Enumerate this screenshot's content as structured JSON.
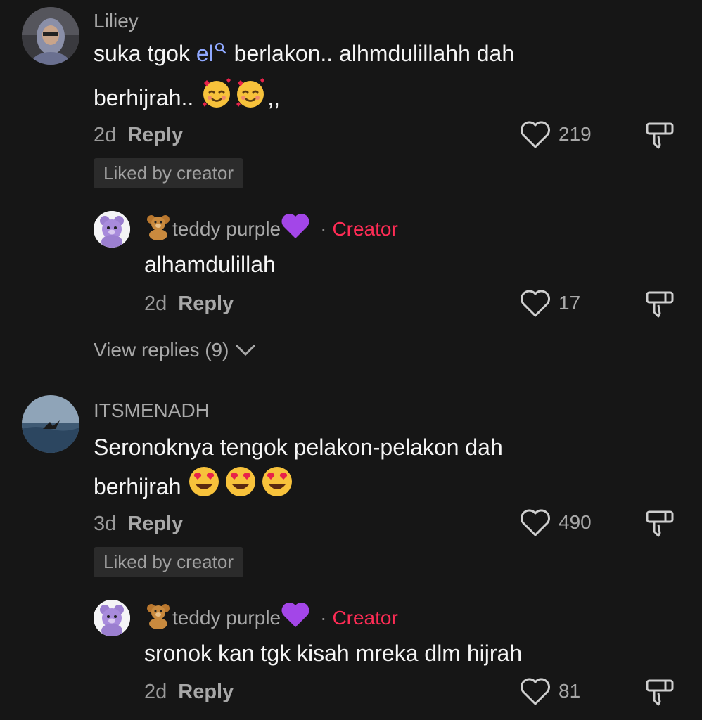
{
  "comments": [
    {
      "username": "Liliey",
      "text_before": "suka tgok ",
      "mention": "el",
      "text_after": " berlakon.. alhmdulillahh dah",
      "line2": "berhijrah.. ",
      "line2_tail": ",,",
      "emoji": "smiling-face-with-hearts",
      "time": "2d",
      "reply_label": "Reply",
      "likes": "219",
      "badge": "Liked by creator",
      "reply": {
        "name": "teddy purple",
        "dot": "·",
        "tag": "Creator",
        "text": "alhamdulillah",
        "time": "2d",
        "reply_label": "Reply",
        "likes": "17"
      },
      "view_replies": "View replies (9)"
    },
    {
      "username": "ITSMENADH",
      "text": "Seronoknya tengok pelakon-pelakon dah",
      "line2": "berhijrah ",
      "emoji": "heart-eyes",
      "time": "3d",
      "reply_label": "Reply",
      "likes": "490",
      "badge": "Liked by creator",
      "reply": {
        "name": "teddy purple",
        "dot": "·",
        "tag": "Creator",
        "text": "sronok kan tgk kisah mreka dlm hijrah",
        "time": "2d",
        "reply_label": "Reply",
        "likes": "81"
      }
    }
  ],
  "colors": {
    "background": "#161616",
    "creator_tag": "#fe2c55",
    "mention": "#8fa8ff",
    "muted": "#a8a8a8"
  }
}
